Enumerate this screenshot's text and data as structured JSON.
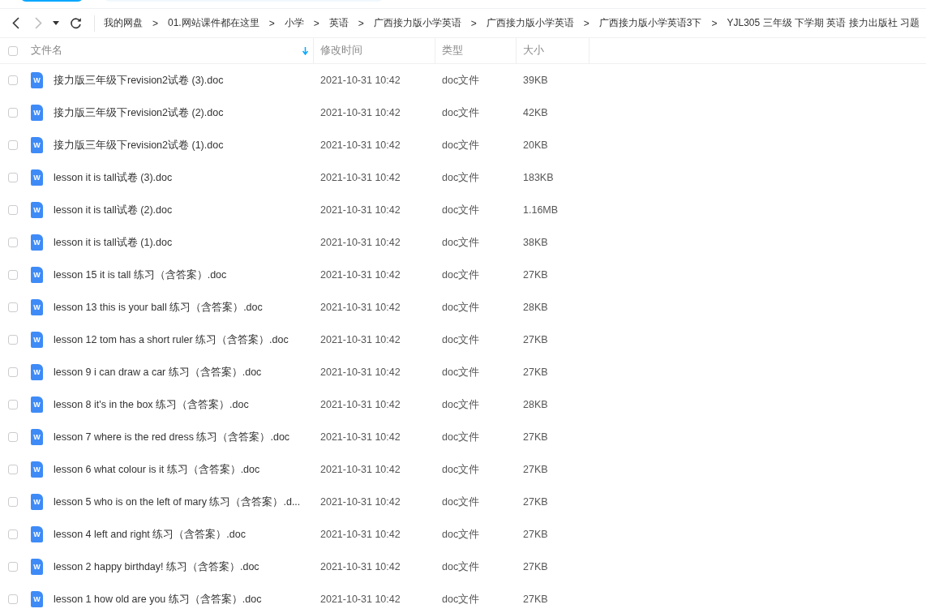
{
  "toolbar": {
    "back_disabled": false,
    "forward_disabled": true,
    "breadcrumbs": [
      {
        "label": "我的网盘"
      },
      {
        "separator": ">",
        "label": "01.网站课件都在这里"
      },
      {
        "separator": ">",
        "label": "小学"
      },
      {
        "separator": ">",
        "label": "英语"
      },
      {
        "separator": ">",
        "label": "广西接力版小学英语"
      },
      {
        "separator": ">",
        "label": "广西接力版小学英语"
      },
      {
        "separator": ">",
        "label": "广西接力版小学英语3下"
      },
      {
        "separator": ">",
        "label": "YJL305 三年级 下学期 英语 接力出版社 习题"
      }
    ]
  },
  "table": {
    "all_checked": false,
    "columns": [
      {
        "label": "文件名",
        "sorted": true
      },
      {
        "label": "修改时间",
        "sorted": false
      },
      {
        "label": "类型",
        "sorted": false
      },
      {
        "label": "大小",
        "sorted": false
      }
    ],
    "rows": [
      {
        "checked": false,
        "icon_label": "W",
        "name": "接力版三年级下revision2试卷 (3).doc",
        "modified": "2021-10-31 10:42",
        "type": "doc文件",
        "size": "39KB"
      },
      {
        "checked": false,
        "icon_label": "W",
        "name": "接力版三年级下revision2试卷 (2).doc",
        "modified": "2021-10-31 10:42",
        "type": "doc文件",
        "size": "42KB"
      },
      {
        "checked": false,
        "icon_label": "W",
        "name": "接力版三年级下revision2试卷 (1).doc",
        "modified": "2021-10-31 10:42",
        "type": "doc文件",
        "size": "20KB"
      },
      {
        "checked": false,
        "icon_label": "W",
        "name": "lesson it is tall试卷 (3).doc",
        "modified": "2021-10-31 10:42",
        "type": "doc文件",
        "size": "183KB"
      },
      {
        "checked": false,
        "icon_label": "W",
        "name": "lesson it is tall试卷 (2).doc",
        "modified": "2021-10-31 10:42",
        "type": "doc文件",
        "size": "1.16MB"
      },
      {
        "checked": false,
        "icon_label": "W",
        "name": "lesson it is tall试卷 (1).doc",
        "modified": "2021-10-31 10:42",
        "type": "doc文件",
        "size": "38KB"
      },
      {
        "checked": false,
        "icon_label": "W",
        "name": "lesson 15 it is tall 练习（含答案）.doc",
        "modified": "2021-10-31 10:42",
        "type": "doc文件",
        "size": "27KB"
      },
      {
        "checked": false,
        "icon_label": "W",
        "name": "lesson 13 this is your ball 练习（含答案）.doc",
        "modified": "2021-10-31 10:42",
        "type": "doc文件",
        "size": "28KB"
      },
      {
        "checked": false,
        "icon_label": "W",
        "name": "lesson 12 tom has a short ruler 练习（含答案）.doc",
        "modified": "2021-10-31 10:42",
        "type": "doc文件",
        "size": "27KB"
      },
      {
        "checked": false,
        "icon_label": "W",
        "name": "lesson 9 i can draw a car 练习（含答案）.doc",
        "modified": "2021-10-31 10:42",
        "type": "doc文件",
        "size": "27KB"
      },
      {
        "checked": false,
        "icon_label": "W",
        "name": "lesson 8 it's in the box 练习（含答案）.doc",
        "modified": "2021-10-31 10:42",
        "type": "doc文件",
        "size": "28KB"
      },
      {
        "checked": false,
        "icon_label": "W",
        "name": "lesson 7 where is the red dress 练习（含答案）.doc",
        "modified": "2021-10-31 10:42",
        "type": "doc文件",
        "size": "27KB"
      },
      {
        "checked": false,
        "icon_label": "W",
        "name": "lesson 6 what colour is it 练习（含答案）.doc",
        "modified": "2021-10-31 10:42",
        "type": "doc文件",
        "size": "27KB"
      },
      {
        "checked": false,
        "icon_label": "W",
        "name": "lesson 5 who is on the left of mary 练习（含答案）.d...",
        "modified": "2021-10-31 10:42",
        "type": "doc文件",
        "size": "27KB"
      },
      {
        "checked": false,
        "icon_label": "W",
        "name": "lesson 4 left and right 练习（含答案）.doc",
        "modified": "2021-10-31 10:42",
        "type": "doc文件",
        "size": "27KB"
      },
      {
        "checked": false,
        "icon_label": "W",
        "name": "lesson 2 happy birthday!  练习（含答案）.doc",
        "modified": "2021-10-31 10:42",
        "type": "doc文件",
        "size": "27KB"
      },
      {
        "checked": false,
        "icon_label": "W",
        "name": "lesson 1 how old are you 练习（含答案）.doc",
        "modified": "2021-10-31 10:42",
        "type": "doc文件",
        "size": "27KB"
      }
    ]
  }
}
